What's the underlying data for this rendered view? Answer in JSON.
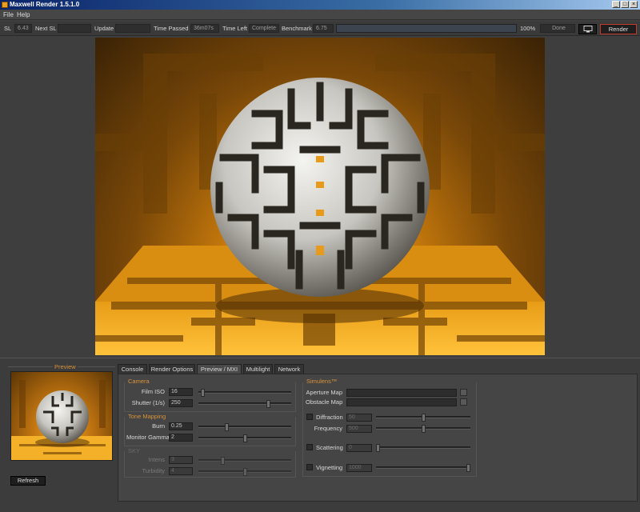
{
  "window": {
    "title": "Maxwell Render 1.5.1.0"
  },
  "menu": {
    "file": "File",
    "help": "Help"
  },
  "status": {
    "sl_label": "SL",
    "sl_value": "6.43",
    "next_sl_label": "Next SL",
    "next_sl_value": "",
    "update_label": "Update",
    "update_value": "",
    "time_passed_label": "Time Passed",
    "time_passed_value": "36m07s",
    "time_left_label": "Time Left",
    "time_left_value": "Complete",
    "benchmark_label": "Benchmark",
    "benchmark_value": "6.75",
    "progress_percent": 100,
    "progress_text": "100%",
    "state": "Done",
    "render_button": "Render"
  },
  "preview": {
    "title": "Preview",
    "refresh_button": "Refresh"
  },
  "tabs": [
    {
      "label": "Console"
    },
    {
      "label": "Render Options"
    },
    {
      "label": "Preview / MXI"
    },
    {
      "label": "Multilight"
    },
    {
      "label": "Network"
    }
  ],
  "camera": {
    "title": "Camera",
    "film_iso_label": "Film ISO",
    "film_iso_value": "16",
    "film_iso_slider": 0.03,
    "shutter_label": "Shutter (1/s)",
    "shutter_value": "250",
    "shutter_slider": 0.77
  },
  "tone_mapping": {
    "title": "Tone Mapping",
    "burn_label": "Burn",
    "burn_value": "0.25",
    "burn_slider": 0.3,
    "gamma_label": "Monitor Gamma",
    "gamma_value": "2",
    "gamma_slider": 0.5
  },
  "disabled_group": {
    "title": "SKY",
    "row1_label": "Intens",
    "row1_value": "3",
    "row1_slider": 0.25,
    "row2_label": "Turbidity",
    "row2_value": "4",
    "row2_slider": 0.5
  },
  "simulens": {
    "title": "Simulens™",
    "aperture_label": "Aperture Map",
    "aperture_value": "",
    "obstacle_label": "Obstacle Map",
    "obstacle_value": "",
    "diffraction_label": "Diffraction",
    "diffraction_value": "50",
    "diffraction_slider": 0.5,
    "frequency_label": "Frequency",
    "frequency_value": "500",
    "frequency_slider": 0.5,
    "scattering_label": "Scattering",
    "scattering_value": "0",
    "scattering_slider": 0.0,
    "vignetting_label": "Vignetting",
    "vignetting_value": "1000",
    "vignetting_slider": 1.0
  },
  "colors": {
    "accent": "#d8923a",
    "render_border": "#c23a2a",
    "scene_orange": "#f3a51a"
  }
}
